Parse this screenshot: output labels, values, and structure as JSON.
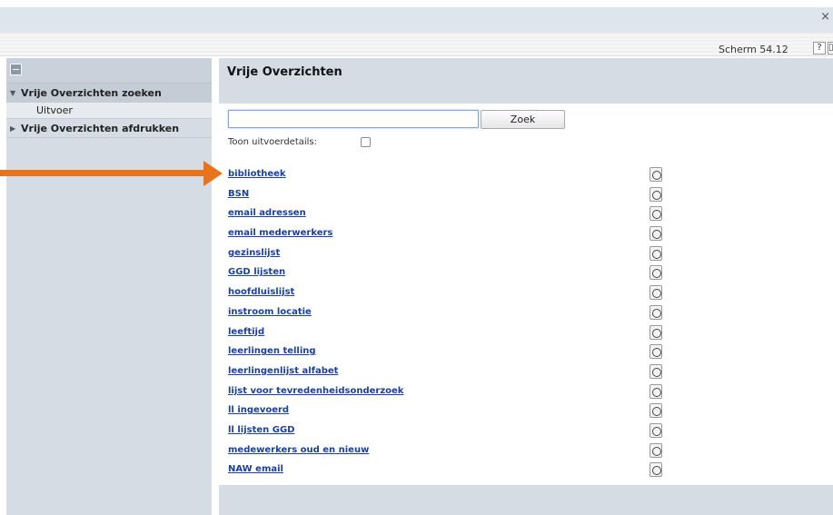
{
  "window": {
    "close_glyph": "×"
  },
  "toolbar": {
    "screen_code": "Scherm 54.12",
    "help_label": "?"
  },
  "sidebar": {
    "items": [
      {
        "label": "Vrije Overzichten zoeken",
        "expanded": true,
        "sub": [
          "Uitvoer"
        ]
      },
      {
        "label": "Vrije Overzichten afdrukken",
        "expanded": false
      }
    ]
  },
  "main": {
    "title": "Vrije Overzichten",
    "search": {
      "value": "",
      "button_label": "Zoek"
    },
    "details_label": "Toon uitvoerdetails:",
    "details_checked": false,
    "reports": [
      "bibliotheek",
      "BSN",
      "email adressen",
      "email mederwerkers",
      "gezinslijst",
      "GGD lijsten",
      "hoofdluislijst",
      "instroom locatie",
      "leeftijd",
      "leerlingen telling",
      "leerlingenlijst alfabet",
      "lijst voor tevredenheidsonderzoek",
      "ll ingevoerd",
      "ll lijsten GGD",
      "medewerkers oud en nieuw",
      "NAW email"
    ]
  },
  "icons": {
    "info": "info-icon",
    "collapse": "collapse-icon"
  },
  "colors": {
    "annotation_arrow": "#e8731a",
    "link": "#1a3fa6",
    "panel": "#d5dce4"
  }
}
